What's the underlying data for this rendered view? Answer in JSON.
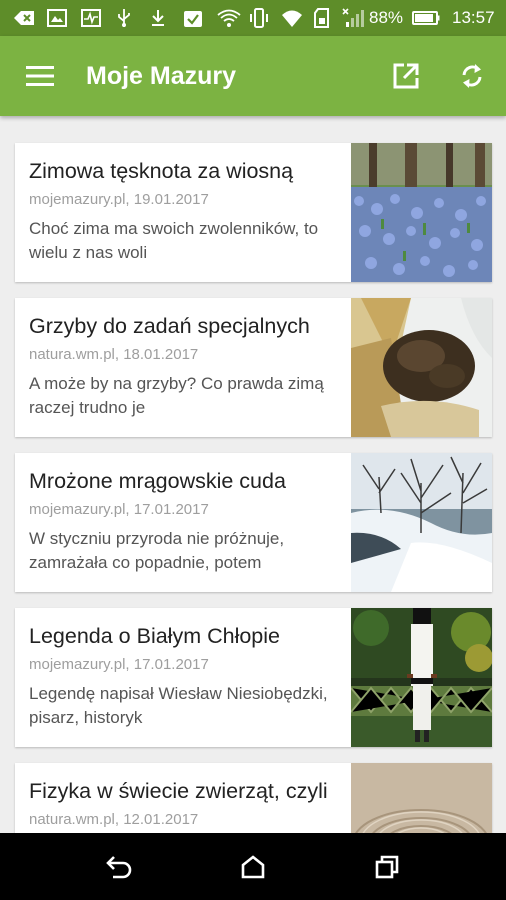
{
  "status_bar": {
    "battery": "88%",
    "time": "13:57",
    "icons": [
      "navigation-icon",
      "image-icon",
      "pulse-icon",
      "usb-icon",
      "download-icon",
      "clipboard-check-icon",
      "wifi-icon",
      "nfc-icon",
      "vibrate-icon",
      "wifi-signal-icon",
      "sd-card-icon",
      "cell-signal-icon",
      "battery-icon"
    ]
  },
  "toolbar": {
    "menu_icon": "menu-icon",
    "title": "Moje Mazury",
    "open_icon": "open-in-new-icon",
    "refresh_icon": "refresh-icon"
  },
  "articles": [
    {
      "title": "Zimowa tęsknota za wiosną",
      "source": "mojemazury.pl, 19.01.2017",
      "excerpt": "Choć zima ma swoich zwolenników, to wielu z nas woli",
      "thumb": "blue-flowers-photo"
    },
    {
      "title": "Grzyby do zadań specjalnych",
      "source": "natura.wm.pl, 18.01.2017",
      "excerpt": "A może by na grzyby? Co prawda zimą raczej trudno je",
      "thumb": "dried-mushrooms-photo"
    },
    {
      "title": "Mrożone mrągowskie cuda",
      "source": "mojemazury.pl, 17.01.2017",
      "excerpt": "W styczniu przyroda nie próżnuje, zamrażała co popadnie, potem",
      "thumb": "frozen-lake-photo"
    },
    {
      "title": "Legenda o Białym Chłopie",
      "source": "mojemazury.pl, 17.01.2017",
      "excerpt": "Legendę napisał Wiesław Niesiobędzki, pisarz, historyk",
      "thumb": "white-figure-statue-photo"
    },
    {
      "title": "Fizyka w świecie zwierząt, czyli",
      "source": "natura.wm.pl, 12.01.2017",
      "excerpt": "",
      "thumb": "water-ripples-photo"
    }
  ],
  "nav_bar": {
    "back_icon": "back-icon",
    "home_icon": "home-icon",
    "recents_icon": "recents-icon"
  },
  "colors": {
    "toolbar": "#7cb342",
    "status_bar": "#5e8d29",
    "background": "#eeeeee",
    "source_text": "#9e9e9e"
  }
}
